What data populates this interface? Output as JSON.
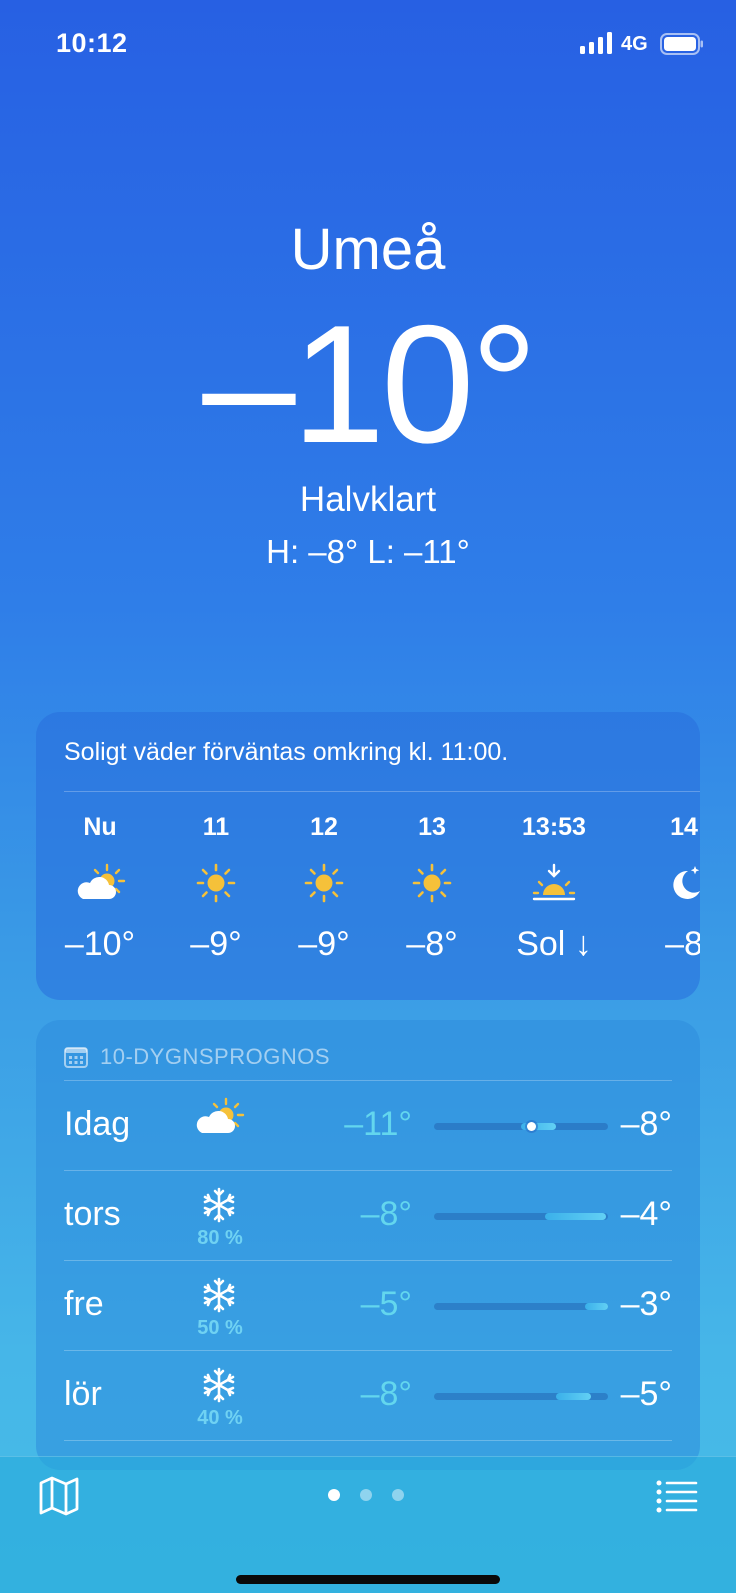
{
  "status_bar": {
    "time": "10:12",
    "network": "4G",
    "icons": [
      "signal-bars-icon",
      "battery-icon"
    ]
  },
  "current": {
    "city": "Umeå",
    "temperature": "–10°",
    "condition": "Halvklart",
    "hilo": "H: –8°  L: –11°"
  },
  "hourly": {
    "summary": "Soligt väder förväntas omkring kl. 11:00.",
    "hours": [
      {
        "label": "Nu",
        "icon": "partly-cloudy-icon",
        "temp": "–10°"
      },
      {
        "label": "11",
        "icon": "sun-icon",
        "temp": "–9°"
      },
      {
        "label": "12",
        "icon": "sun-icon",
        "temp": "–9°"
      },
      {
        "label": "13",
        "icon": "sun-icon",
        "temp": "–8°"
      },
      {
        "label": "13:53",
        "icon": "sunset-icon",
        "temp": "Sol ↓"
      },
      {
        "label": "14",
        "icon": "moon-stars-icon",
        "temp": "–8"
      }
    ]
  },
  "daily": {
    "header": "10-DYGNSPROGNOS",
    "days": [
      {
        "day": "Idag",
        "icon": "partly-cloudy-icon",
        "precip": "",
        "low": "–11°",
        "high": "–8°",
        "range_start_pct": 50,
        "range_end_pct": 70,
        "current_pct": 56
      },
      {
        "day": "tors",
        "icon": "snowflake-icon",
        "precip": "80 %",
        "low": "–8°",
        "high": "–4°",
        "range_start_pct": 64,
        "range_end_pct": 99
      },
      {
        "day": "fre",
        "icon": "snowflake-icon",
        "precip": "50 %",
        "low": "–5°",
        "high": "–3°",
        "range_start_pct": 87,
        "range_end_pct": 100
      },
      {
        "day": "lör",
        "icon": "snowflake-icon",
        "precip": "40 %",
        "low": "–8°",
        "high": "–5°",
        "range_start_pct": 70,
        "range_end_pct": 90
      }
    ]
  },
  "bottom_bar": {
    "left_icon": "map-icon",
    "right_icon": "list-icon",
    "pages": 3,
    "active_page": 1
  }
}
